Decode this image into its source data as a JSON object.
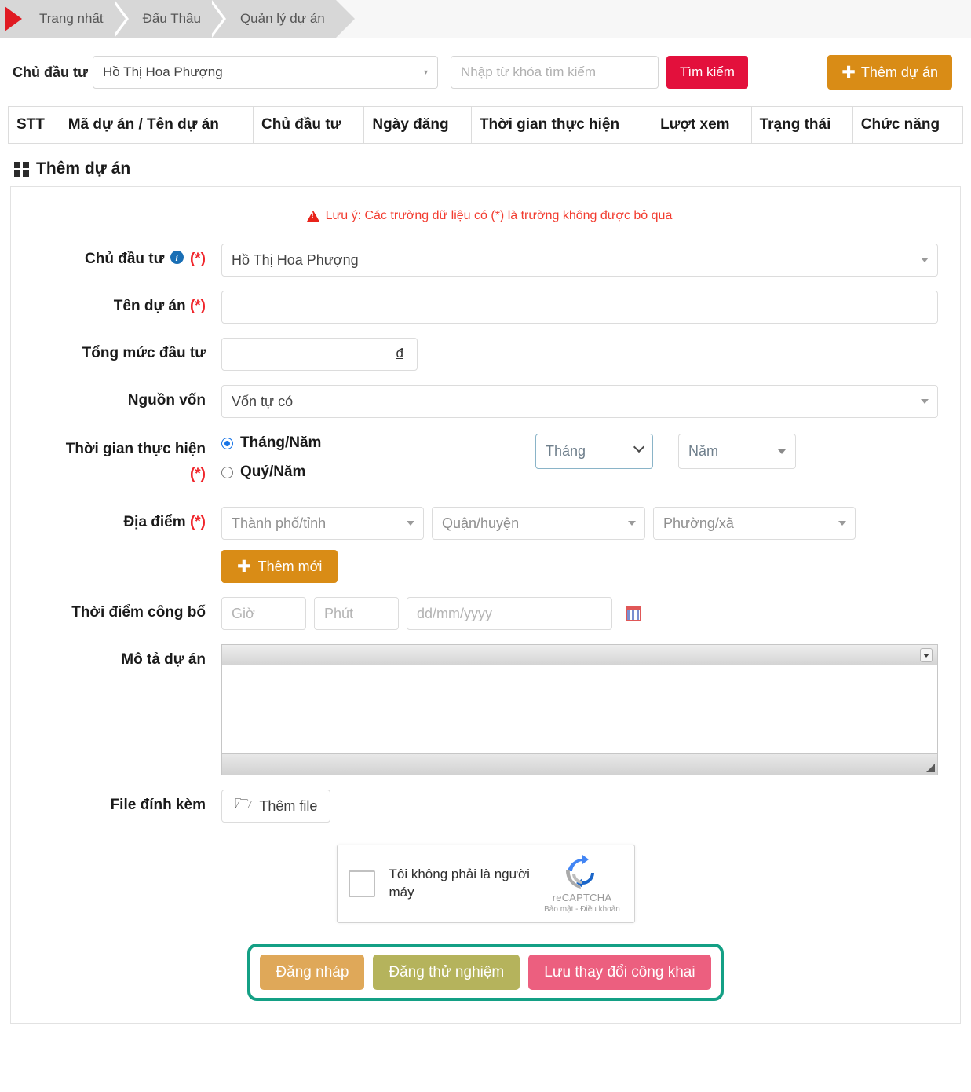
{
  "breadcrumb": {
    "items": [
      {
        "label": "Trang nhất"
      },
      {
        "label": "Đấu Thầu"
      },
      {
        "label": "Quản lý dự án"
      }
    ]
  },
  "filter": {
    "investor_label": "Chủ đầu tư",
    "investor_value": "Hồ Thị Hoa Phượng",
    "search_placeholder": "Nhập từ khóa tìm kiếm",
    "search_value": "",
    "search_button": "Tìm kiếm",
    "add_project_button": "Thêm dự án",
    "accent_search": "#e3103c",
    "accent_add": "#d98c16"
  },
  "table": {
    "columns": [
      "STT",
      "Mã dự án / Tên dự án",
      "Chủ đầu tư",
      "Ngày đăng",
      "Thời gian thực hiện",
      "Lượt xem",
      "Trạng thái",
      "Chức năng"
    ]
  },
  "section": {
    "title": "Thêm dự án",
    "note": "Lưu ý: Các trường dữ liệu có (*) là trường không được bỏ qua",
    "note_color": "#f23b2f"
  },
  "form": {
    "investor": {
      "label": "Chủ đầu tư",
      "required": "(*)",
      "value": "Hồ Thị Hoa Phượng"
    },
    "project_name": {
      "label": "Tên dự án",
      "required": "(*)",
      "value": "",
      "placeholder": ""
    },
    "total_investment": {
      "label": "Tổng mức đầu tư",
      "value": "",
      "currency": "đ"
    },
    "funding_source": {
      "label": "Nguồn vốn",
      "value": "Vốn tự có"
    },
    "period": {
      "label": "Thời gian thực hiện",
      "required": "(*)",
      "option_month": "Tháng/Năm",
      "option_quarter": "Quý/Năm",
      "selected": "Tháng/Năm",
      "month_placeholder": "Tháng",
      "year_placeholder": "Năm"
    },
    "location": {
      "label": "Địa điểm",
      "required": "(*)",
      "province_placeholder": "Thành phố/tỉnh",
      "district_placeholder": "Quận/huyện",
      "ward_placeholder": "Phường/xã",
      "add_button": "Thêm mới"
    },
    "publish_time": {
      "label": "Thời điểm công bố",
      "hour_placeholder": "Giờ",
      "minute_placeholder": "Phút",
      "date_placeholder": "dd/mm/yyyy",
      "hour_value": "",
      "minute_value": "",
      "date_value": ""
    },
    "description": {
      "label": "Mô tả dự án",
      "value": ""
    },
    "attachment": {
      "label": "File đính kèm",
      "button": "Thêm file"
    }
  },
  "recaptcha": {
    "checkbox_label": "Tôi không phải là người máy",
    "brand": "reCAPTCHA",
    "links": "Bảo mật - Điều khoản",
    "checked": false
  },
  "actions": {
    "highlight_color": "#14a085",
    "buttons": [
      {
        "label": "Đăng nháp",
        "color": "#dfa859"
      },
      {
        "label": "Đăng thử nghiệm",
        "color": "#b5b35c"
      },
      {
        "label": "Lưu thay đổi công khai",
        "color": "#ec5f7f"
      }
    ]
  }
}
